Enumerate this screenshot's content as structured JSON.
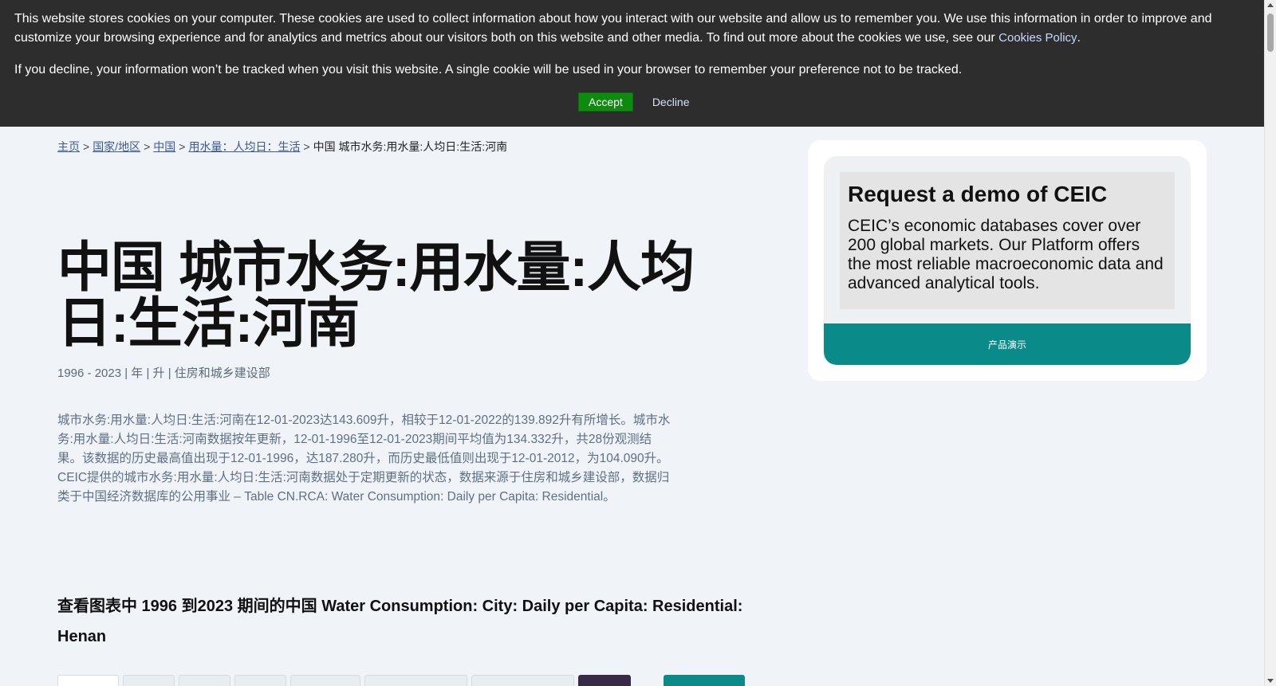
{
  "cookie_banner": {
    "text1": "This website stores cookies on your computer. These cookies are used to collect information about how you interact with our website and allow us to remember you. We use this information in order to improve and customize your browsing experience and for analytics and metrics about our visitors both on this website and other media. To find out more about the cookies we use, see our ",
    "policy_link": "Cookies Policy",
    "text1_end": ".",
    "text2": "If you decline, your information won’t be tracked when you visit this website. A single cookie will be used in your browser to remember your preference not to be tracked.",
    "accept_label": "Accept",
    "decline_label": "Decline"
  },
  "breadcrumb": {
    "items": [
      "主页",
      "国家/地区",
      "中国",
      "用水量：人均日：生活"
    ],
    "separator": ">",
    "current": "中国 城市水务:用水量:人均日:生活:河南"
  },
  "page": {
    "title": "中国 城市水务:用水量:人均日:生活:河南",
    "meta": "1996 - 2023 | 年 | 升 | 住房和城乡建设部",
    "description": "城市水务:用水量:人均日:生活:河南在12-01-2023达143.609升，相较于12-01-2022的139.892升有所增长。城市水务:用水量:人均日:生活:河南数据按年更新，12-01-1996至12-01-2023期间平均值为134.332升，共28份观测结果。该数据的历史最高值出现于12-01-1996，达187.280升，而历史最低值则出现于12-01-2012，为104.090升。CEIC提供的城市水务:用水量:人均日:生活:河南数据处于定期更新的状态，数据来源于住房和城乡建设部，数据归类于中国经济数据库的公用事业 – Table CN.RCA: Water Consumption: Daily per Capita: Residential。",
    "chart_heading": "查看图表中 1996 到2023 期间的中国 Water Consumption: City: Daily per Capita: Residential: Henan"
  },
  "demo": {
    "title": "Request a demo of CEIC",
    "body": "CEIC’s economic databases cover over 200 global markets. Our Platform offers the most reliable macroeconomic data and advanced analytical tools.",
    "button_label": "产品演示"
  },
  "colors": {
    "banner_bg": "#2d2d2d",
    "accept_green": "#0e8a0e",
    "teal": "#0b8a8a",
    "page_bg": "#f0f4f8"
  }
}
